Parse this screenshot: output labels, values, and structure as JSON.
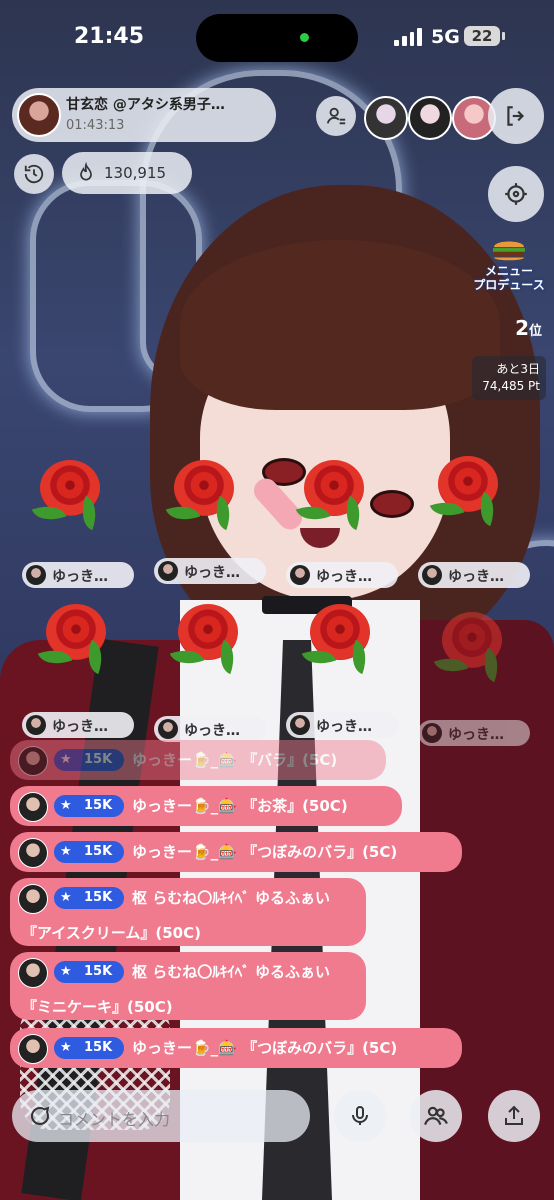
{
  "status_bar": {
    "time": "21:45",
    "network": "5G",
    "battery": "22"
  },
  "streamer": {
    "name": "甘玄恋 @アタシ系男子…",
    "elapsed": "01:43:13"
  },
  "fire_count": "130,915",
  "event": {
    "title": "メニュー\nプロデュース",
    "rank_number": "2",
    "rank_suffix": "位",
    "days_left": "あと3日",
    "points": "74,485 Pt"
  },
  "gift_tags": [
    "ゆっき…",
    "ゆっき…",
    "ゆっき…",
    "ゆっき…",
    "ゆっき…",
    "ゆっき…",
    "ゆっき…",
    "ゆっき…"
  ],
  "chat": [
    {
      "badge": "15K",
      "line1": "ゆっきー🍺_🎰 『バラ』(5C)",
      "line2": "",
      "faded": true
    },
    {
      "badge": "15K",
      "line1": "ゆっきー🍺_🎰 『お茶』(50C)",
      "line2": "",
      "faded": false
    },
    {
      "badge": "15K",
      "line1": "ゆっきー🍺_🎰 『つぼみのバラ』(5C)",
      "line2": "",
      "faded": false
    },
    {
      "badge": "15K",
      "line1": "枢 らむね〇ﾙｷｲﾍﾞ ゆるふぁい",
      "line2": "『アイスクリーム』(50C)",
      "faded": false
    },
    {
      "badge": "15K",
      "line1": "枢 らむね〇ﾙｷｲﾍﾞ ゆるふぁい",
      "line2": "『ミニケーキ』(50C)",
      "faded": false
    },
    {
      "badge": "15K",
      "line1": "ゆっきー🍺_🎰 『つぼみのバラ』(5C)",
      "line2": "",
      "faded": false
    }
  ],
  "comment_placeholder": "コメントを入力",
  "icons": {
    "history": "history-icon",
    "fire": "fire-icon",
    "follow": "add-user-icon",
    "exit": "exit-icon",
    "target": "target-icon",
    "comment": "chat-icon",
    "mic": "mic-icon",
    "people": "people-icon",
    "share": "share-icon"
  }
}
